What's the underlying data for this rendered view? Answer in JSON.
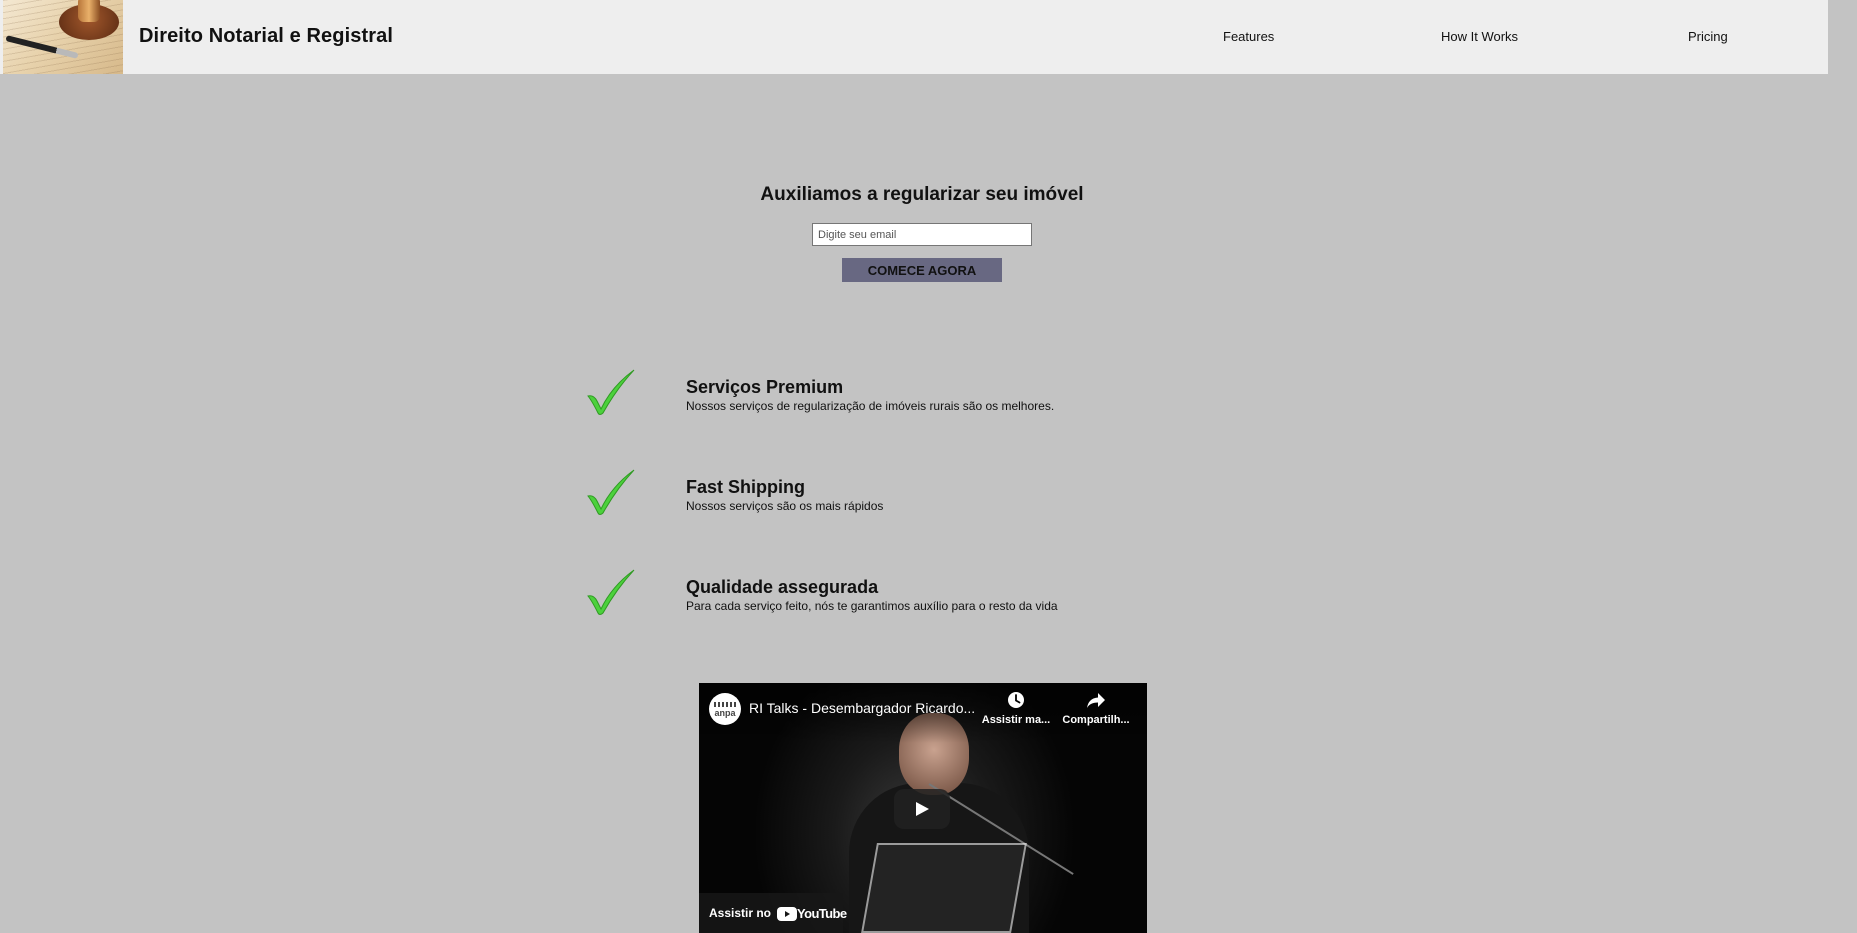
{
  "header": {
    "logo_icon": "notary-seal-and-pen-image",
    "site_title": "Direito Notarial e Registral",
    "nav": [
      {
        "label": "Features"
      },
      {
        "label": "How It Works"
      },
      {
        "label": "Pricing"
      }
    ]
  },
  "hero": {
    "title": "Auxiliamos a regularizar seu imóvel",
    "email_placeholder": "Digite seu email",
    "email_value": "",
    "cta_label": "COMECE AGORA"
  },
  "features": [
    {
      "icon": "checkmark-icon",
      "title": "Serviços Premium",
      "description": "Nossos serviços de regularização de imóveis rurais são os melhores."
    },
    {
      "icon": "checkmark-icon",
      "title": "Fast Shipping",
      "description": "Nossos serviços são os mais rápidos"
    },
    {
      "icon": "checkmark-icon",
      "title": "Qualidade assegurada",
      "description": "Para cada serviço feito, nós te garantimos auxílio para o resto da vida"
    }
  ],
  "video": {
    "channel_avatar_text": "anpa",
    "title": "RI Talks - Desembargador Ricardo...",
    "watch_later_label": "Assistir ma...",
    "share_label": "Compartilh...",
    "watch_on_label": "Assistir no",
    "youtube_label": "YouTube"
  },
  "colors": {
    "page_background": "#c3c3c3",
    "header_background": "#eeeeee",
    "cta_background": "#686882",
    "check_green": "#4cd13c"
  }
}
